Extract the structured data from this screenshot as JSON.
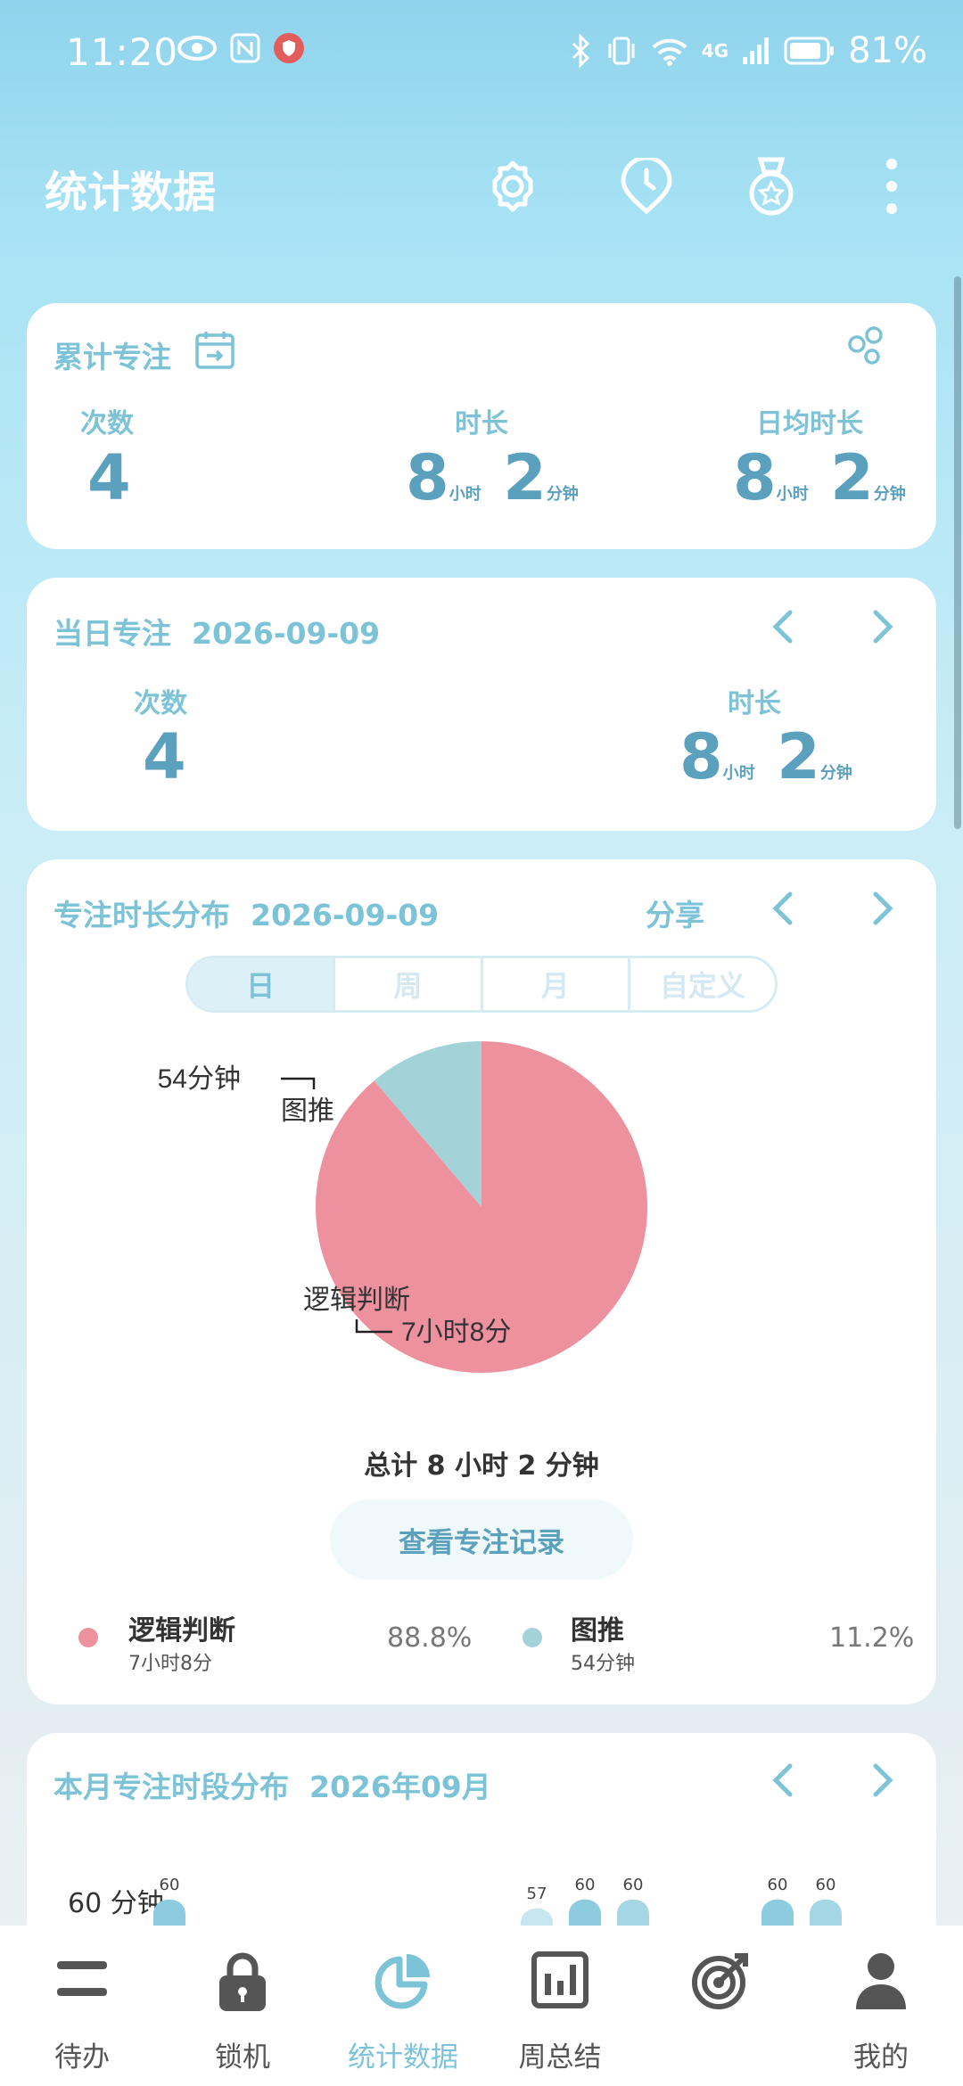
{
  "status_bar": {
    "time": "11:20",
    "battery": "81%",
    "network": "4G"
  },
  "app_bar": {
    "title": "统计数据"
  },
  "total_card": {
    "title": "累计专注",
    "count_label": "次数",
    "count": "4",
    "duration_label": "时长",
    "duration_hours": "8",
    "duration_minutes": "2",
    "avg_label": "日均时长",
    "avg_hours": "8",
    "avg_minutes": "2",
    "hour_unit": "小时",
    "minute_unit": "分钟"
  },
  "day_card": {
    "title": "当日专注",
    "date": "2026-09-09",
    "count_label": "次数",
    "count": "4",
    "duration_label": "时长",
    "duration_hours": "8",
    "duration_minutes": "2",
    "hour_unit": "小时",
    "minute_unit": "分钟"
  },
  "dist_card": {
    "title": "专注时长分布",
    "date": "2026-09-09",
    "share": "分享",
    "segments": [
      "日",
      "周",
      "月",
      "自定义"
    ],
    "pie_label_small": "54分钟",
    "pie_name_small": "图推",
    "pie_name_large": "逻辑判断",
    "pie_label_large": "7小时8分",
    "total": "总计 8 小时 2 分钟",
    "view_records": "查看专注记录",
    "legend": [
      {
        "name": "逻辑判断",
        "time": "7小时8分",
        "percent": "88.8%",
        "color": "#ee919e"
      },
      {
        "name": "图推",
        "time": "54分钟",
        "percent": "11.2%",
        "color": "#a3d3d9"
      }
    ]
  },
  "chart_data": {
    "type": "pie",
    "categories": [
      "逻辑判断",
      "图推"
    ],
    "values": [
      428,
      54
    ],
    "labels": [
      "7小时8分",
      "54分钟"
    ],
    "percent": [
      88.8,
      11.2
    ],
    "colors": [
      "#ee919e",
      "#a3d3d9"
    ]
  },
  "month_card": {
    "title": "本月专注时段分布",
    "date": "2026年09月",
    "y_label": "60 分钟",
    "bars": [
      {
        "value": "60"
      },
      {
        "value": "57"
      },
      {
        "value": "60"
      },
      {
        "value": "60"
      },
      {
        "value": "60"
      },
      {
        "value": "60"
      }
    ]
  },
  "bottom_nav": [
    {
      "label": "待办",
      "icon": "list-icon"
    },
    {
      "label": "锁机",
      "icon": "lock-icon"
    },
    {
      "label": "统计数据",
      "icon": "pie-chart-icon"
    },
    {
      "label": "周总结",
      "icon": "bar-board-icon"
    },
    {
      "label": "",
      "icon": "target-icon"
    },
    {
      "label": "我的",
      "icon": "person-icon"
    }
  ]
}
